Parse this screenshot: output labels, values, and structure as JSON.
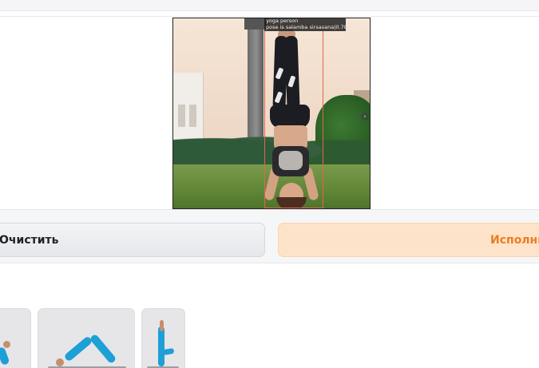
{
  "output": {
    "detection_label_line1": "yoga person",
    "detection_label_line2": "pose is salamba sirsasana|0.78",
    "detection_box_color": "#e0664a",
    "next_icon": "chevron-right-icon",
    "next_glyph": "›"
  },
  "actions": {
    "clear_label": "Очистить",
    "run_label": "Исполнить",
    "run_color": "#ea7d1f",
    "run_bg": "#fde3c9"
  },
  "examples": {
    "items": [
      {
        "name": "example-thumbnail-seated-pose"
      },
      {
        "name": "example-thumbnail-downward-dog"
      },
      {
        "name": "example-thumbnail-standing-pose"
      }
    ]
  }
}
